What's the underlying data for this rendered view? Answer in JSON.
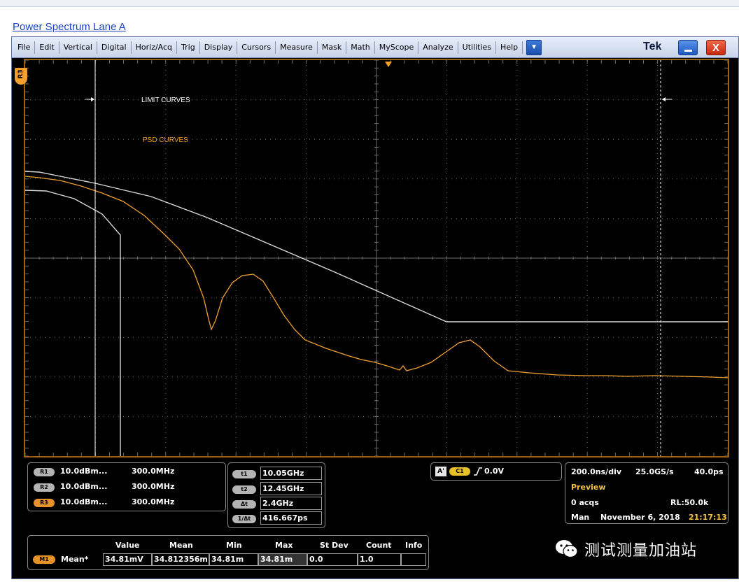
{
  "page": {
    "title": "Power Spectrum Lane A"
  },
  "menu": {
    "items": [
      "File",
      "Edit",
      "Vertical",
      "Digital",
      "Horiz/Acq",
      "Trig",
      "Display",
      "Cursors",
      "Measure",
      "Mask",
      "Math",
      "MyScope",
      "Analyze",
      "Utilities",
      "Help"
    ],
    "brand": "Tek",
    "close_label": "X"
  },
  "display": {
    "ref_marker": "R3",
    "labels": {
      "limit_curves": "LIMIT CURVES",
      "psd_curves": "PSD CURVES"
    },
    "colors": {
      "psd": "#f0a030",
      "limit": "#d8d8d8",
      "grid": "#6e6e6e",
      "frame": "#9b6413"
    }
  },
  "references": [
    {
      "tag": "R1",
      "scale": "10.0dBm...",
      "freq": "300.0MHz"
    },
    {
      "tag": "R2",
      "scale": "10.0dBm...",
      "freq": "300.0MHz"
    },
    {
      "tag": "R3",
      "scale": "10.0dBm...",
      "freq": "300.0MHz"
    }
  ],
  "cursors": [
    {
      "tag": "t1",
      "value": "10.05GHz"
    },
    {
      "tag": "t2",
      "value": "12.45GHz"
    },
    {
      "tag": "Δt",
      "value": "2.4GHz"
    },
    {
      "tag": "1/Δt",
      "value": "416.667ps"
    }
  ],
  "trigger": {
    "mode": "A'",
    "source": "C1",
    "level": "0.0V"
  },
  "acquisition": {
    "time_div": "200.0ns/div",
    "sample_rate": "25.0GS/s",
    "resolution": "40.0ps",
    "mode": "Preview",
    "acqs": "0 acqs",
    "record_length": "RL:50.0k",
    "run_mode": "Man",
    "date": "November 6, 2018",
    "time": "21:17:13"
  },
  "measurement": {
    "headers": [
      "Value",
      "Mean",
      "Min",
      "Max",
      "St Dev",
      "Count",
      "Info"
    ],
    "row": {
      "tag": "M1",
      "name": "Mean*",
      "value": "34.81mV",
      "mean": "34.812356m",
      "min": "34.81m",
      "max": "34.81m",
      "stdev": "0.0",
      "count": "1.0",
      "info": ""
    }
  },
  "watermark": {
    "text": "测试测量加油站"
  }
}
